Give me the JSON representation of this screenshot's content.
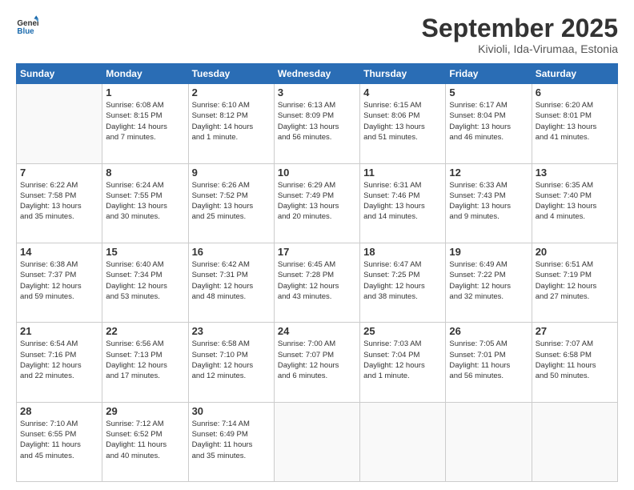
{
  "logo": {
    "line1": "General",
    "line2": "Blue"
  },
  "title": "September 2025",
  "subtitle": "Kivioli, Ida-Virumaa, Estonia",
  "weekdays": [
    "Sunday",
    "Monday",
    "Tuesday",
    "Wednesday",
    "Thursday",
    "Friday",
    "Saturday"
  ],
  "weeks": [
    [
      {
        "day": "",
        "info": ""
      },
      {
        "day": "1",
        "info": "Sunrise: 6:08 AM\nSunset: 8:15 PM\nDaylight: 14 hours\nand 7 minutes."
      },
      {
        "day": "2",
        "info": "Sunrise: 6:10 AM\nSunset: 8:12 PM\nDaylight: 14 hours\nand 1 minute."
      },
      {
        "day": "3",
        "info": "Sunrise: 6:13 AM\nSunset: 8:09 PM\nDaylight: 13 hours\nand 56 minutes."
      },
      {
        "day": "4",
        "info": "Sunrise: 6:15 AM\nSunset: 8:06 PM\nDaylight: 13 hours\nand 51 minutes."
      },
      {
        "day": "5",
        "info": "Sunrise: 6:17 AM\nSunset: 8:04 PM\nDaylight: 13 hours\nand 46 minutes."
      },
      {
        "day": "6",
        "info": "Sunrise: 6:20 AM\nSunset: 8:01 PM\nDaylight: 13 hours\nand 41 minutes."
      }
    ],
    [
      {
        "day": "7",
        "info": "Sunrise: 6:22 AM\nSunset: 7:58 PM\nDaylight: 13 hours\nand 35 minutes."
      },
      {
        "day": "8",
        "info": "Sunrise: 6:24 AM\nSunset: 7:55 PM\nDaylight: 13 hours\nand 30 minutes."
      },
      {
        "day": "9",
        "info": "Sunrise: 6:26 AM\nSunset: 7:52 PM\nDaylight: 13 hours\nand 25 minutes."
      },
      {
        "day": "10",
        "info": "Sunrise: 6:29 AM\nSunset: 7:49 PM\nDaylight: 13 hours\nand 20 minutes."
      },
      {
        "day": "11",
        "info": "Sunrise: 6:31 AM\nSunset: 7:46 PM\nDaylight: 13 hours\nand 14 minutes."
      },
      {
        "day": "12",
        "info": "Sunrise: 6:33 AM\nSunset: 7:43 PM\nDaylight: 13 hours\nand 9 minutes."
      },
      {
        "day": "13",
        "info": "Sunrise: 6:35 AM\nSunset: 7:40 PM\nDaylight: 13 hours\nand 4 minutes."
      }
    ],
    [
      {
        "day": "14",
        "info": "Sunrise: 6:38 AM\nSunset: 7:37 PM\nDaylight: 12 hours\nand 59 minutes."
      },
      {
        "day": "15",
        "info": "Sunrise: 6:40 AM\nSunset: 7:34 PM\nDaylight: 12 hours\nand 53 minutes."
      },
      {
        "day": "16",
        "info": "Sunrise: 6:42 AM\nSunset: 7:31 PM\nDaylight: 12 hours\nand 48 minutes."
      },
      {
        "day": "17",
        "info": "Sunrise: 6:45 AM\nSunset: 7:28 PM\nDaylight: 12 hours\nand 43 minutes."
      },
      {
        "day": "18",
        "info": "Sunrise: 6:47 AM\nSunset: 7:25 PM\nDaylight: 12 hours\nand 38 minutes."
      },
      {
        "day": "19",
        "info": "Sunrise: 6:49 AM\nSunset: 7:22 PM\nDaylight: 12 hours\nand 32 minutes."
      },
      {
        "day": "20",
        "info": "Sunrise: 6:51 AM\nSunset: 7:19 PM\nDaylight: 12 hours\nand 27 minutes."
      }
    ],
    [
      {
        "day": "21",
        "info": "Sunrise: 6:54 AM\nSunset: 7:16 PM\nDaylight: 12 hours\nand 22 minutes."
      },
      {
        "day": "22",
        "info": "Sunrise: 6:56 AM\nSunset: 7:13 PM\nDaylight: 12 hours\nand 17 minutes."
      },
      {
        "day": "23",
        "info": "Sunrise: 6:58 AM\nSunset: 7:10 PM\nDaylight: 12 hours\nand 12 minutes."
      },
      {
        "day": "24",
        "info": "Sunrise: 7:00 AM\nSunset: 7:07 PM\nDaylight: 12 hours\nand 6 minutes."
      },
      {
        "day": "25",
        "info": "Sunrise: 7:03 AM\nSunset: 7:04 PM\nDaylight: 12 hours\nand 1 minute."
      },
      {
        "day": "26",
        "info": "Sunrise: 7:05 AM\nSunset: 7:01 PM\nDaylight: 11 hours\nand 56 minutes."
      },
      {
        "day": "27",
        "info": "Sunrise: 7:07 AM\nSunset: 6:58 PM\nDaylight: 11 hours\nand 50 minutes."
      }
    ],
    [
      {
        "day": "28",
        "info": "Sunrise: 7:10 AM\nSunset: 6:55 PM\nDaylight: 11 hours\nand 45 minutes."
      },
      {
        "day": "29",
        "info": "Sunrise: 7:12 AM\nSunset: 6:52 PM\nDaylight: 11 hours\nand 40 minutes."
      },
      {
        "day": "30",
        "info": "Sunrise: 7:14 AM\nSunset: 6:49 PM\nDaylight: 11 hours\nand 35 minutes."
      },
      {
        "day": "",
        "info": ""
      },
      {
        "day": "",
        "info": ""
      },
      {
        "day": "",
        "info": ""
      },
      {
        "day": "",
        "info": ""
      }
    ]
  ]
}
